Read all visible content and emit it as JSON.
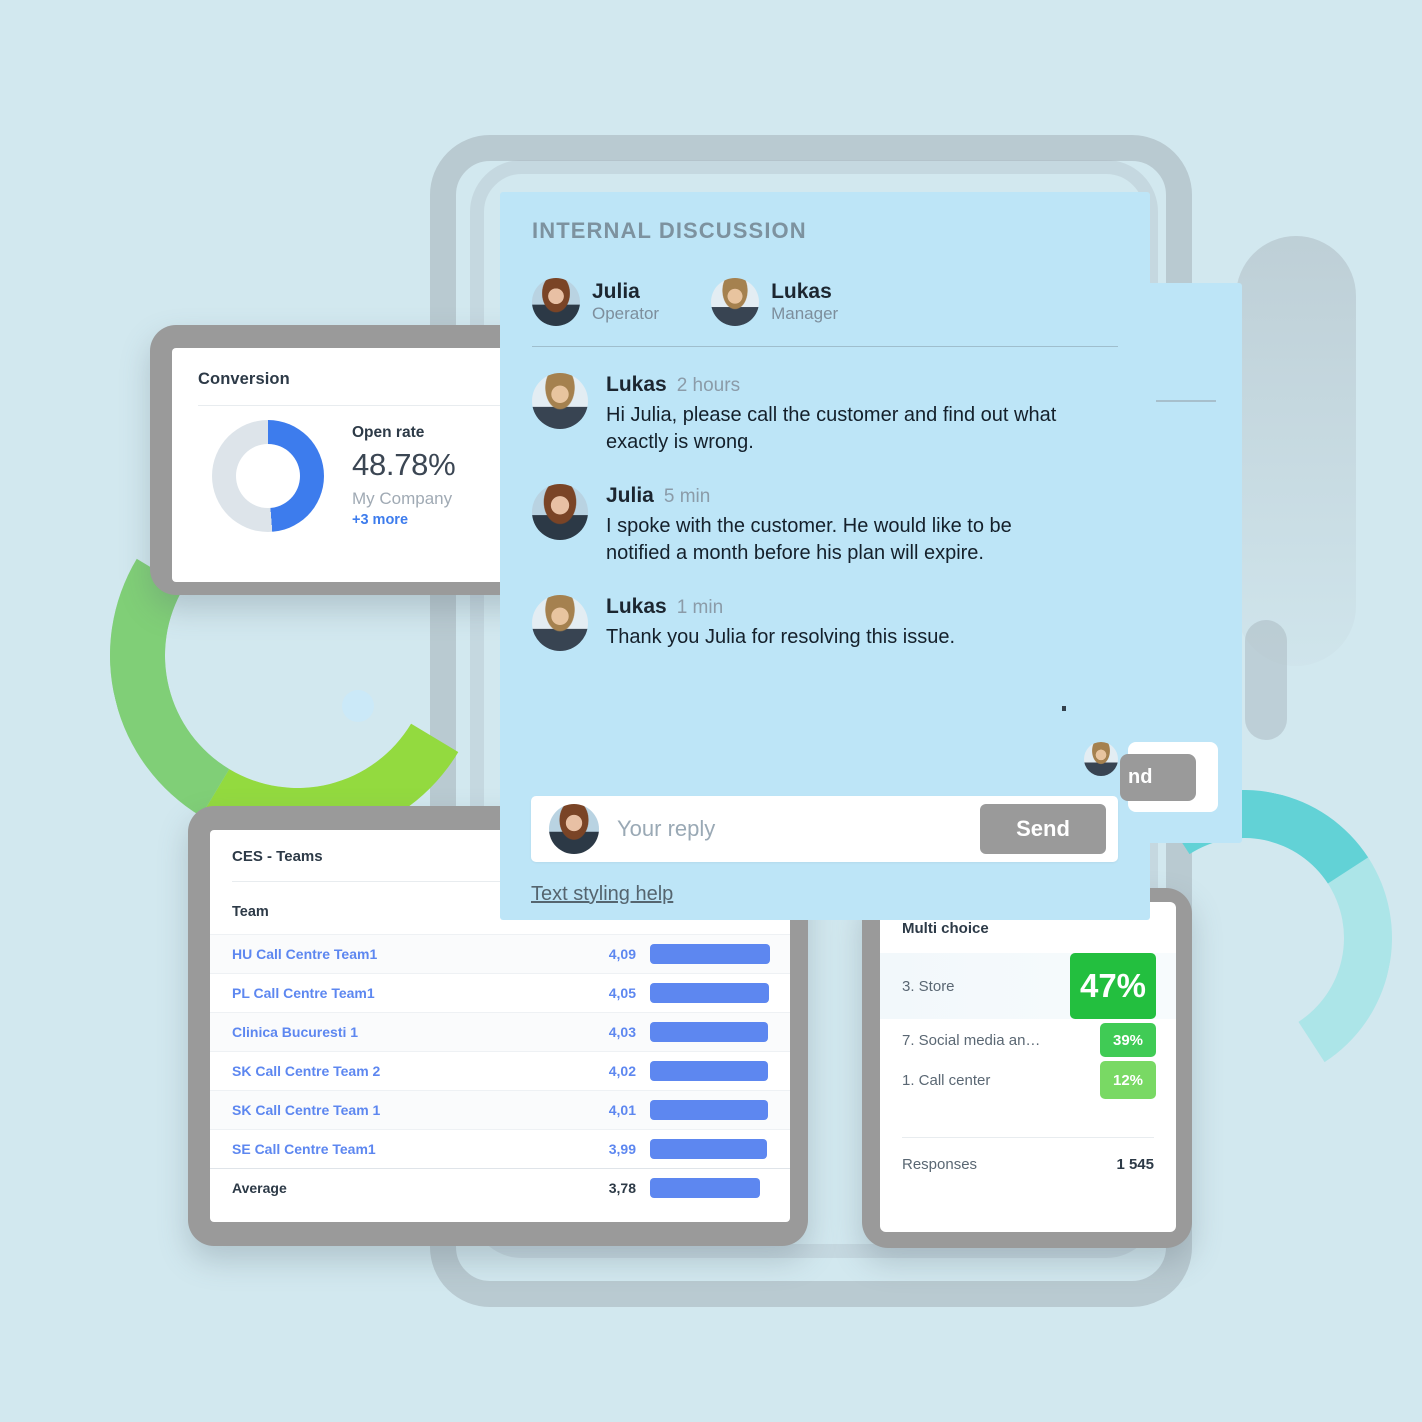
{
  "theme": {
    "page_background": "#d2e8ef",
    "chat_card_background": "#bde5f7",
    "accent_blue": "#3d7ced",
    "bar_blue": "#5d87f0",
    "green_strong": "#23bf3f",
    "green_mid": "#40cb55",
    "green_light": "#79d964",
    "send_button_grey": "#9a9a9a"
  },
  "conversion_card": {
    "title": "Conversion",
    "stat_label": "Open rate",
    "stat_value": "48.78%",
    "company": "My Company",
    "more_link": "+3 more",
    "chart_data": {
      "type": "pie",
      "title": "Conversion",
      "categories": [
        "Open rate",
        "Remaining"
      ],
      "values": [
        48.78,
        51.22
      ],
      "labels": [
        "48.78%",
        ""
      ],
      "colors": [
        "#3d7ced",
        "#dde4ea"
      ],
      "donut": true,
      "legend": "none",
      "annotations": [
        "Open rate",
        "48.78%",
        "My Company",
        "+3 more"
      ]
    }
  },
  "ces_card": {
    "title": "CES - Teams",
    "column_header": "Team",
    "chart_data": {
      "type": "bar",
      "title": "CES - Teams",
      "xlabel": "",
      "ylabel": "Team",
      "orientation": "horizontal",
      "categories": [
        "HU Call Centre Team1",
        "PL Call Centre Team1",
        "Clinica Bucuresti 1",
        "SK Call Centre Team 2",
        "SK Call Centre Team 1",
        "SE Call Centre Team1",
        "Average"
      ],
      "values": [
        4.09,
        4.05,
        4.03,
        4.02,
        4.01,
        3.99,
        3.78
      ],
      "value_labels": [
        "4,09",
        "4,05",
        "4,03",
        "4,02",
        "4,01",
        "3,99",
        "3,78"
      ],
      "bar_widths_pct": [
        100,
        99,
        98.5,
        98,
        98,
        97.5,
        92
      ],
      "grid": false,
      "legend": "none"
    },
    "rows": [
      {
        "name": "HU Call Centre Team1",
        "value": "4,09",
        "bar_pct": 100,
        "alt": true,
        "average": false
      },
      {
        "name": "PL Call Centre Team1",
        "value": "4,05",
        "bar_pct": 99,
        "alt": false,
        "average": false
      },
      {
        "name": "Clinica Bucuresti 1",
        "value": "4,03",
        "bar_pct": 98.5,
        "alt": true,
        "average": false
      },
      {
        "name": "SK Call Centre Team 2",
        "value": "4,02",
        "bar_pct": 98,
        "alt": false,
        "average": false
      },
      {
        "name": "SK Call Centre Team 1",
        "value": "4,01",
        "bar_pct": 98,
        "alt": true,
        "average": false
      },
      {
        "name": "SE Call Centre Team1",
        "value": "3,99",
        "bar_pct": 97.5,
        "alt": false,
        "average": false
      },
      {
        "name": "Average",
        "value": "3,78",
        "bar_pct": 92,
        "alt": false,
        "average": true
      }
    ]
  },
  "multi_choice_card": {
    "title": "Multi choice",
    "responses_label": "Responses",
    "responses_value": "1 545",
    "chart_data": {
      "type": "bar",
      "title": "Multi choice",
      "categories": [
        "3. Store",
        "7. Social media an…",
        "1. Call center"
      ],
      "values": [
        47,
        39,
        12
      ],
      "value_labels": [
        "47%",
        "39%",
        "12%"
      ],
      "colors": [
        "#23bf3f",
        "#40cb55",
        "#79d964"
      ],
      "ylabel": "",
      "xlabel": "",
      "legend": "none",
      "annotations": [
        "Responses: 1 545"
      ]
    },
    "options": [
      {
        "label": "3. Store",
        "pct": "47%",
        "size": "big"
      },
      {
        "label": "7. Social media an…",
        "pct": "39%",
        "size": "mid"
      },
      {
        "label": "1. Call center",
        "pct": "12%",
        "size": "small"
      }
    ]
  },
  "chat_card": {
    "heading": "INTERNAL DISCUSSION",
    "participants": [
      {
        "name": "Julia",
        "role": "Operator",
        "avatar": "julia"
      },
      {
        "name": "Lukas",
        "role": "Manager",
        "avatar": "lukas"
      }
    ],
    "messages": [
      {
        "author": "Lukas",
        "time": "2 hours",
        "avatar": "lukas",
        "text": "Hi Julia, please call the customer and find out what exactly is wrong."
      },
      {
        "author": "Julia",
        "time": "5 min",
        "avatar": "julia",
        "text": "I spoke with the customer. He would like to be notified a month before his plan will expire."
      },
      {
        "author": "Lukas",
        "time": "1 min",
        "avatar": "lukas",
        "text": "Thank you Julia for resolving this issue."
      }
    ],
    "reply": {
      "placeholder": "Your reply",
      "value": "",
      "send_label": "Send",
      "styling_help_label": "Text styling help"
    },
    "ghost_send_label": "nd"
  }
}
